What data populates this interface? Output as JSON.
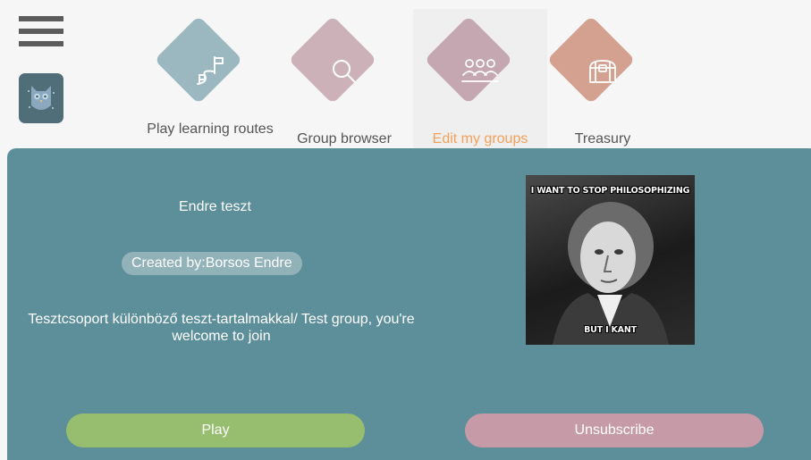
{
  "nav": {
    "items": [
      {
        "label": "Play learning routes",
        "icon": "learning-route-icon",
        "color": "#9bb8c0"
      },
      {
        "label": "Group browser",
        "icon": "search-icon",
        "color": "#cdb1b9"
      },
      {
        "label": "Edit my groups",
        "icon": "group-icon",
        "color": "#c4a7b1"
      },
      {
        "label": "Treasury",
        "icon": "treasure-chest-icon",
        "color": "#d4a190"
      }
    ],
    "active_color": "#f4a05a",
    "label_color": "#555555"
  },
  "group": {
    "title": "Endre teszt",
    "created_by": "Created by:Borsos Endre",
    "description": "Tesztcsoport különböző teszt-tartalmakkal/ Test group, you're welcome to join",
    "image": {
      "top_text": "I WANT TO STOP PHILOSOPHIZING",
      "bottom_text": "BUT I KANT"
    }
  },
  "actions": {
    "play_label": "Play",
    "unsubscribe_label": "Unsubscribe"
  },
  "colors": {
    "panel": "#5d8f9b",
    "play": "#97bd6f",
    "unsubscribe": "#c79aa7"
  }
}
